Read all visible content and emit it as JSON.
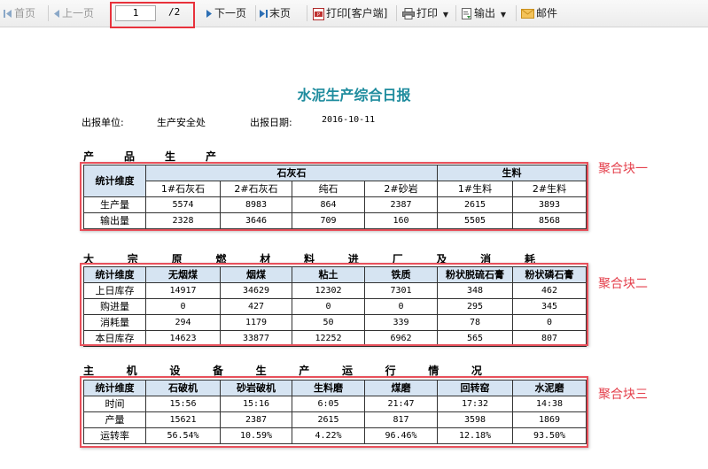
{
  "toolbar": {
    "first": "首页",
    "prev": "上一页",
    "page_current": "1",
    "page_total": "/2",
    "next": "下一页",
    "last": "末页",
    "print_client": "打印[客户端]",
    "print": "打印",
    "export": "输出",
    "mail": "邮件"
  },
  "report": {
    "title": "水泥生产综合日报",
    "unit_label": "出报单位:",
    "unit_value": "生产安全处",
    "date_label": "出报日期:",
    "date_value": "2016-10-11"
  },
  "block1": {
    "section_chars": [
      "产",
      "品",
      "生",
      "产"
    ],
    "corner": "统计维度",
    "group1": "石灰石",
    "group2": "生料",
    "sub": [
      "1#石灰石",
      "2#石灰石",
      "纯石",
      "2#砂岩",
      "1#生料",
      "2#生料"
    ],
    "rows": [
      {
        "label": "生产量",
        "cells": [
          "5574",
          "8983",
          "864",
          "2387",
          "2615",
          "3893"
        ]
      },
      {
        "label": "输出量",
        "cells": [
          "2328",
          "3646",
          "709",
          "160",
          "5505",
          "8568"
        ]
      }
    ],
    "tag": "聚合块一"
  },
  "block2": {
    "section_chars": [
      "大",
      "宗",
      "原",
      "燃",
      "材",
      "料",
      "进",
      "厂",
      "及",
      "消",
      "耗"
    ],
    "headers": [
      "统计维度",
      "无烟煤",
      "烟煤",
      "粘土",
      "铁质",
      "粉状脱硫石膏",
      "粉状磷石膏"
    ],
    "rows": [
      {
        "label": "上日库存",
        "cells": [
          "14917",
          "34629",
          "12302",
          "7301",
          "348",
          "462"
        ]
      },
      {
        "label": "购进量",
        "cells": [
          "0",
          "427",
          "0",
          "0",
          "295",
          "345"
        ]
      },
      {
        "label": "消耗量",
        "cells": [
          "294",
          "1179",
          "50",
          "339",
          "78",
          "0"
        ]
      },
      {
        "label": "本日库存",
        "cells": [
          "14623",
          "33877",
          "12252",
          "6962",
          "565",
          "807"
        ]
      }
    ],
    "tag": "聚合块二"
  },
  "block3": {
    "section_chars": [
      "主",
      "机",
      "设",
      "备",
      "生",
      "产",
      "运",
      "行",
      "情",
      "况"
    ],
    "headers": [
      "统计维度",
      "石破机",
      "砂岩破机",
      "生料磨",
      "煤磨",
      "回转窑",
      "水泥磨"
    ],
    "rows": [
      {
        "label": "时间",
        "cells": [
          "15:56",
          "15:16",
          "6:05",
          "21:47",
          "17:32",
          "14:38"
        ]
      },
      {
        "label": "产量",
        "cells": [
          "15621",
          "2387",
          "2615",
          "817",
          "3598",
          "1869"
        ]
      },
      {
        "label": "运转率",
        "cells": [
          "56.54%",
          "10.59%",
          "4.22%",
          "96.46%",
          "12.18%",
          "93.50%"
        ]
      }
    ],
    "tag": "聚合块三"
  },
  "colors": {
    "title": "#1f8c9e",
    "header_bg": "#d6e4f2",
    "highlight": "#e8323c",
    "tag_text": "#e4404c"
  },
  "icons": {
    "first": "first-page-icon",
    "prev": "prev-page-icon",
    "next": "next-page-icon",
    "last": "last-page-icon",
    "print_client": "pdf-print-icon",
    "print": "printer-icon",
    "export": "export-icon",
    "mail": "mail-icon"
  }
}
